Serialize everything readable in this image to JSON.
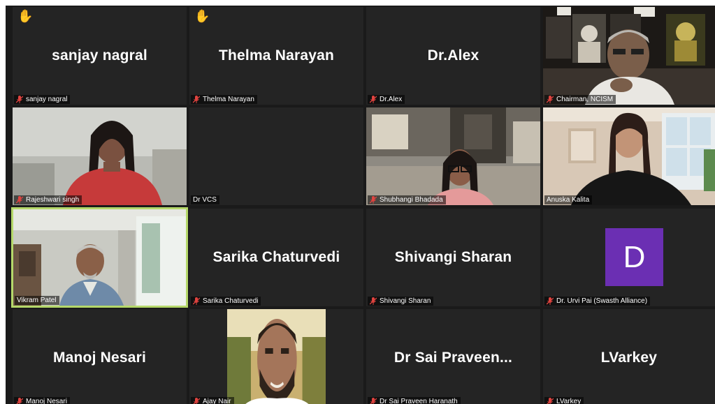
{
  "participants": [
    {
      "name": "sanjay nagral",
      "display": "sanjay nagral",
      "hand": true,
      "muted": true
    },
    {
      "name": "Thelma Narayan",
      "display": "Thelma Narayan",
      "hand": true,
      "muted": true
    },
    {
      "name": "Dr.Alex",
      "display": "Dr.Alex",
      "muted": true
    },
    {
      "name": "Chairman, NCISM",
      "muted": true
    },
    {
      "name": "Rajeshwari singh",
      "muted": true
    },
    {
      "name": "Dr VCS",
      "muted": false
    },
    {
      "name": "Shubhangi Bhadada",
      "muted": true
    },
    {
      "name": "Anuska Kalita",
      "muted": false
    },
    {
      "name": "Vikram Patel",
      "muted": false,
      "active_speaker": true
    },
    {
      "name": "Sarika Chaturvedi",
      "display": "Sarika Chaturvedi",
      "muted": true
    },
    {
      "name": "Shivangi Sharan",
      "display": "Shivangi Sharan",
      "muted": true
    },
    {
      "name": "Dr. Urvi Pai (Swasth Alliance)",
      "avatar_letter": "D",
      "muted": true
    },
    {
      "name": "Manoj Nesari",
      "display": "Manoj Nesari",
      "muted": true
    },
    {
      "name": "Ajay Nair",
      "muted": true
    },
    {
      "name": "Dr Sai Praveen Haranath",
      "display": "Dr Sai Praveen...",
      "muted": true
    },
    {
      "name": "LVarkey",
      "display": "LVarkey",
      "muted": true
    }
  ],
  "colors": {
    "tile_bg": "#242424",
    "grid_bg": "#1a1a1a",
    "speaker_border": "#b5d86a",
    "muted_mic": "#e0433f",
    "avatar_bg": "#6b2fb3"
  },
  "icons": {
    "hand": "raised-hand-icon",
    "mic": "muted-mic-icon"
  }
}
